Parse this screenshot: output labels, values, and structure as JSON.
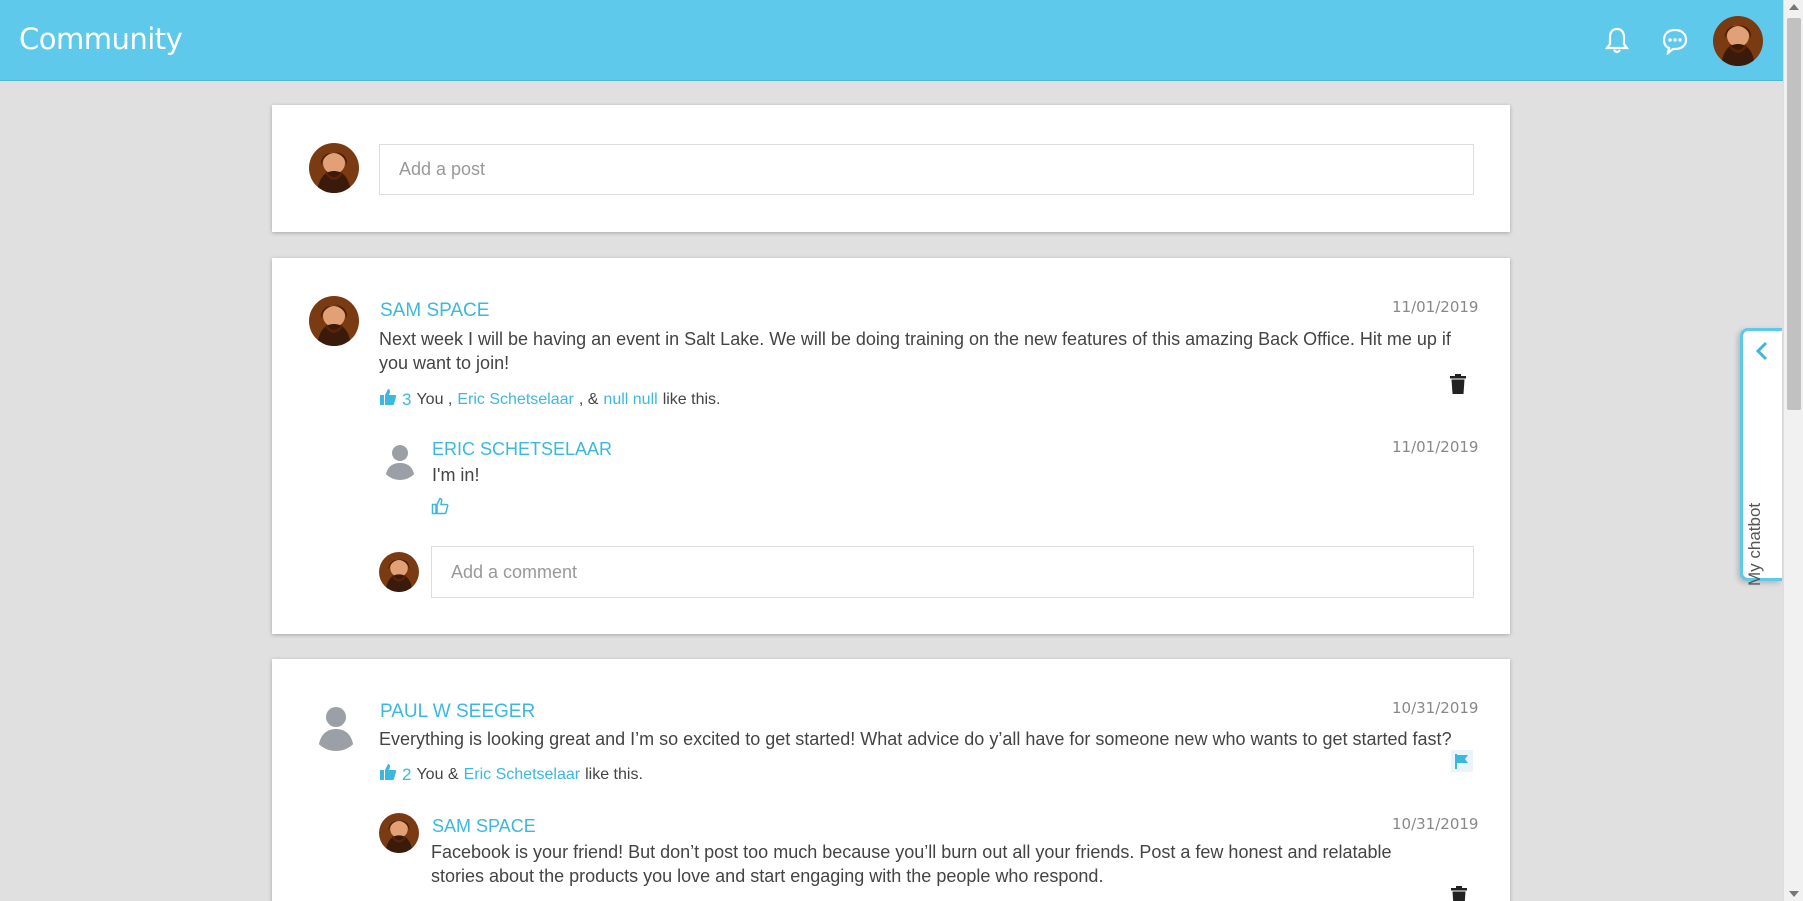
{
  "header": {
    "title": "Community",
    "icons": [
      "bell-icon",
      "chat-bubble-icon",
      "avatar"
    ]
  },
  "composer": {
    "placeholder": "Add a post"
  },
  "posts": [
    {
      "author": "SAM SPACE",
      "date": "11/01/2019",
      "text": "Next week I will be having an event in Salt Lake. We will be doing training on the new features of this amazing Back Office. Hit me up if you want to join!",
      "like_count": "3",
      "likes_you": "You ,",
      "likes_name1": "Eric Schetselaar",
      "likes_sep": ", &",
      "likes_name2": "null null",
      "likes_suffix": "like this.",
      "action": "trash-icon",
      "comments": [
        {
          "author": "ERIC SCHETSELAAR",
          "date": "11/01/2019",
          "text": "I'm in!"
        }
      ],
      "comment_placeholder": "Add a comment"
    },
    {
      "author": "PAUL W SEEGER",
      "date": "10/31/2019",
      "text": "Everything is looking great and I’m so excited to get started! What advice do y’all have for someone new who wants to get started fast?",
      "like_count": "2",
      "likes_you": "You &",
      "likes_name1": "Eric Schetselaar",
      "likes_suffix": "like this.",
      "action": "flag-icon",
      "comments": [
        {
          "author": "SAM SPACE",
          "date": "10/31/2019",
          "text": "Facebook is your friend! But don’t post too much because you’ll burn out all your friends. Post a few honest and relatable stories about the products you love and start engaging with the people who respond."
        }
      ]
    }
  ],
  "chatbot": {
    "label": "My chatbot"
  },
  "colors": {
    "header": "#5ec9ea",
    "accent": "#3cb8e0",
    "background": "#e0e0e0"
  }
}
